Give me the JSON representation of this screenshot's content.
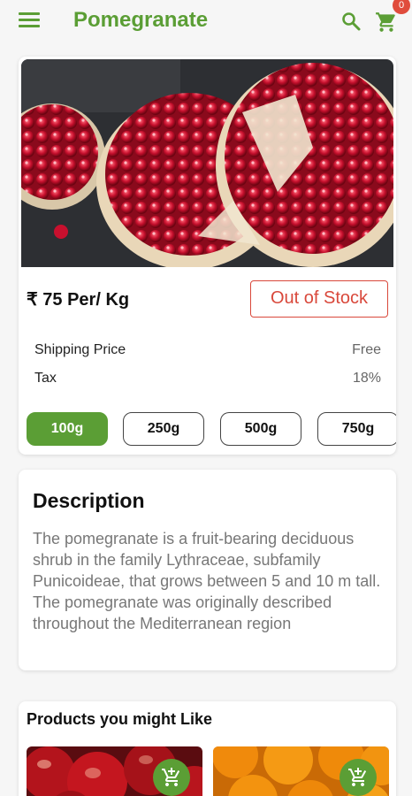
{
  "header": {
    "title": "Pomegranate",
    "cart_count": "0",
    "menu_icon": "menu-icon",
    "search_icon": "search-icon",
    "cart_icon": "cart-icon"
  },
  "product": {
    "price": "₹ 75 Per/ Kg",
    "stock_status": "Out of Stock",
    "info": [
      {
        "label": "Shipping Price",
        "value": "Free"
      },
      {
        "label": "Tax",
        "value": "18%"
      }
    ],
    "weights": [
      "100g",
      "250g",
      "500g",
      "750g"
    ],
    "selected_weight": "100g"
  },
  "description": {
    "title": "Description",
    "text": "The pomegranate is a fruit-bearing deciduous shrub in the family Lythraceae, subfamily Punicoideae, that grows between 5 and 10 m tall. The pomegranate was originally described throughout the Mediterranean region"
  },
  "related": {
    "title": "Products you might Like",
    "add_icon": "add-shopping-cart-icon"
  },
  "colors": {
    "brand": "#5b9e35",
    "out_of_stock": "#d9483b",
    "badge": "#e04c3c"
  }
}
